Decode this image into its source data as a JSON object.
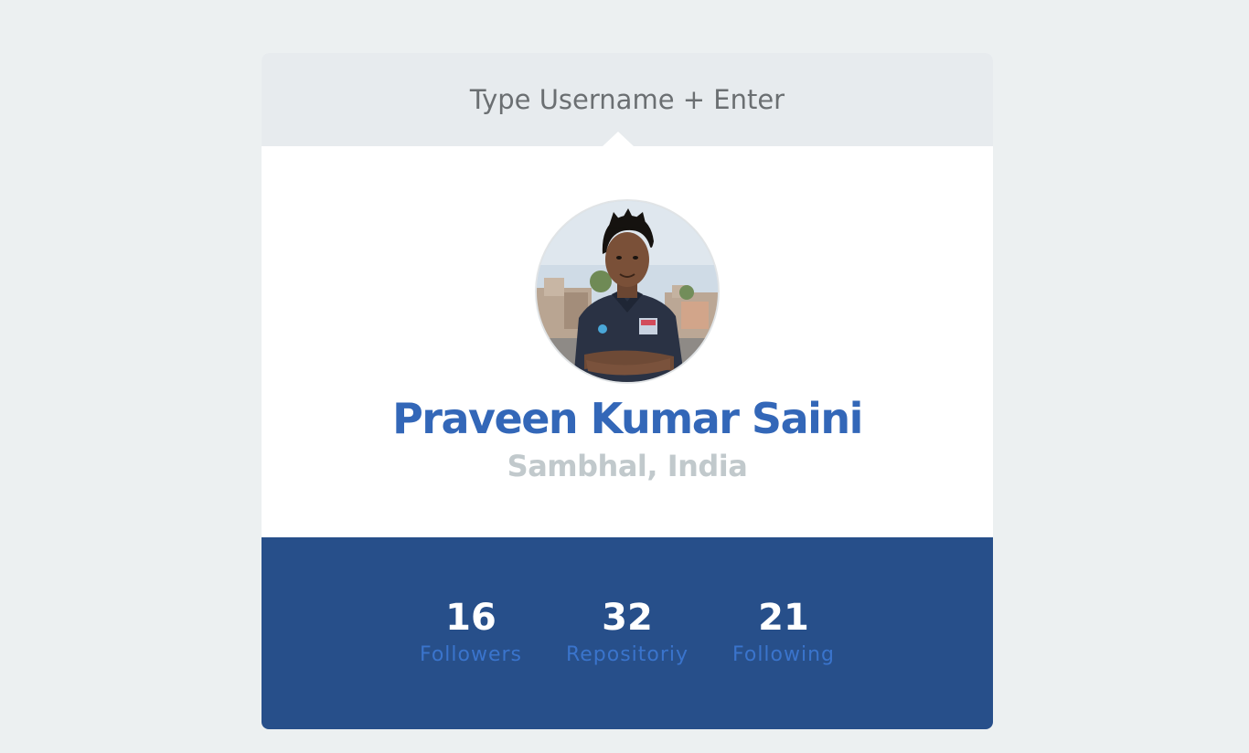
{
  "search": {
    "placeholder": "Type Username + Enter"
  },
  "profile": {
    "name": "Praveen Kumar Saini",
    "location": "Sambhal, India",
    "avatar_icon": "user-photo"
  },
  "stats": {
    "followers": {
      "value": "16",
      "label": "Followers"
    },
    "repositories": {
      "value": "32",
      "label": "Repositoriy"
    },
    "following": {
      "value": "21",
      "label": "Following"
    }
  },
  "colors": {
    "page_background": "#ecf0f1",
    "search_background": "#e7ebee",
    "name_blue": "#3367b8",
    "location_gray": "#c1c9cc",
    "stats_background": "#274f8a",
    "stats_label_blue": "#3a74cc"
  }
}
